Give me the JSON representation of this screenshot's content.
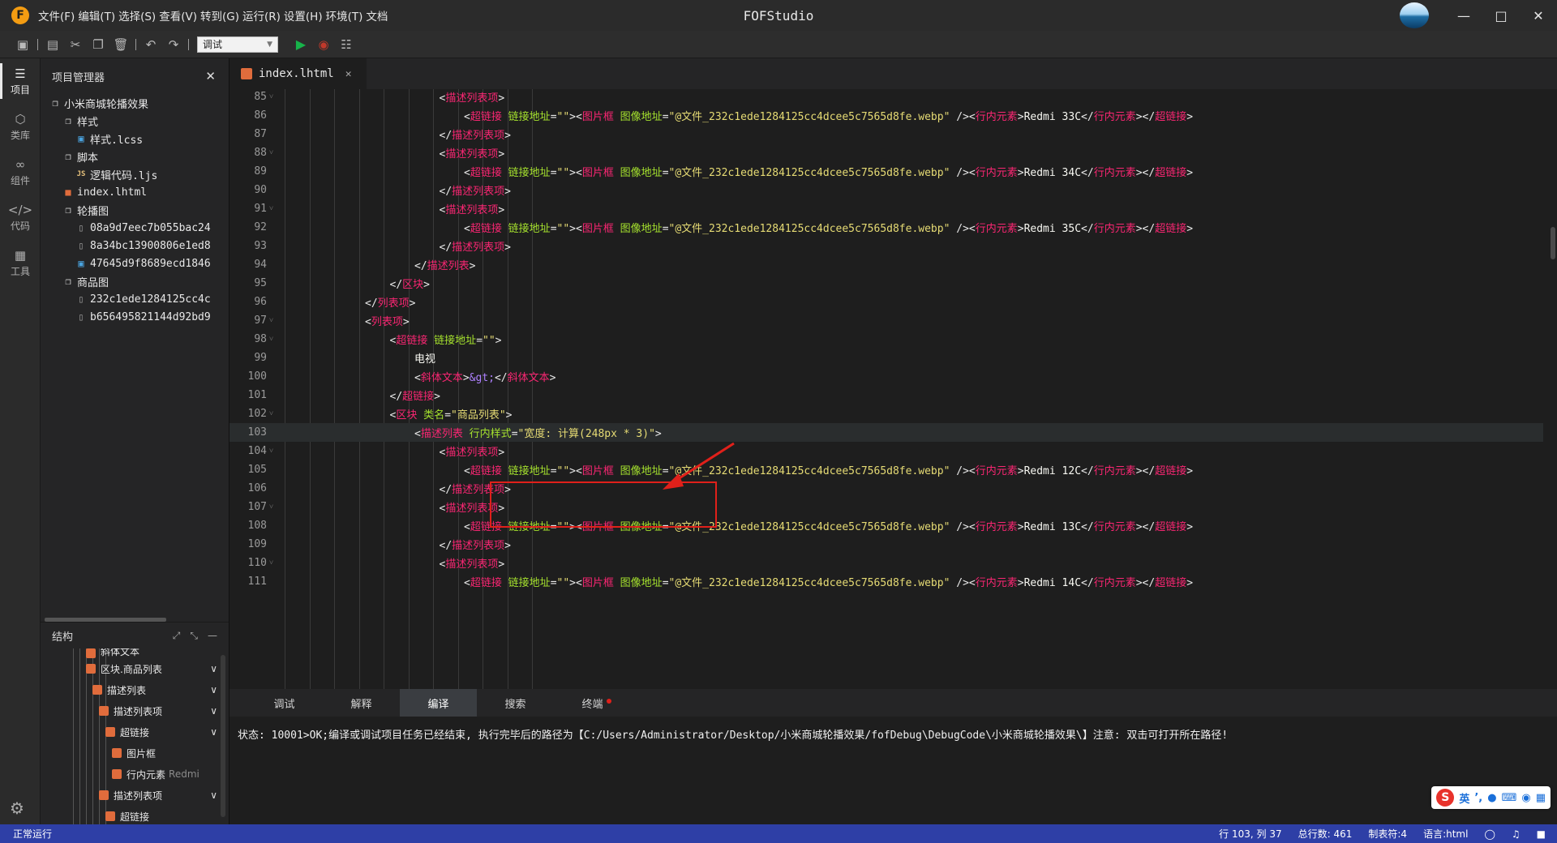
{
  "app": {
    "title": "FOFStudio",
    "logo_letter": "F"
  },
  "menu": [
    "文件(F)",
    "编辑(T)",
    "选择(S)",
    "查看(V)",
    "转到(G)",
    "运行(R)",
    "设置(H)",
    "环境(T)",
    "文档"
  ],
  "toolbar": {
    "run_mode": "调试",
    "icons": [
      "save-icon",
      "save-all-icon",
      "cut-icon",
      "copy-icon",
      "delete-icon",
      "undo-icon",
      "redo-icon",
      "run-icon",
      "stop-icon",
      "search-files-icon"
    ]
  },
  "activity": [
    {
      "label": "项目",
      "icon": "layers-icon"
    },
    {
      "label": "类库",
      "icon": "cube-icon"
    },
    {
      "label": "组件",
      "icon": "link-icon"
    },
    {
      "label": "代码",
      "icon": "code-icon"
    },
    {
      "label": "工具",
      "icon": "tools-icon"
    }
  ],
  "project_panel": {
    "title": "项目管理器",
    "tree": [
      {
        "label": "小米商城轮播效果",
        "type": "folder",
        "depth": 0
      },
      {
        "label": "样式",
        "type": "folder",
        "depth": 1
      },
      {
        "label": "样式.lcss",
        "type": "css",
        "depth": 2
      },
      {
        "label": "脚本",
        "type": "folder",
        "depth": 1
      },
      {
        "label": "逻辑代码.ljs",
        "type": "js",
        "depth": 2
      },
      {
        "label": "index.lhtml",
        "type": "html",
        "depth": 1
      },
      {
        "label": "轮播图",
        "type": "folder",
        "depth": 1
      },
      {
        "label": "08a9d7eec7b055bac24",
        "type": "file",
        "depth": 2
      },
      {
        "label": "8a34bc13900806e1ed8",
        "type": "file",
        "depth": 2
      },
      {
        "label": "47645d9f8689ecd1846",
        "type": "image",
        "depth": 2
      },
      {
        "label": "商品图",
        "type": "folder",
        "depth": 1
      },
      {
        "label": "232c1ede1284125cc4c",
        "type": "file",
        "depth": 2
      },
      {
        "label": "b656495821144d92bd9",
        "type": "file",
        "depth": 2
      }
    ]
  },
  "structure_panel": {
    "title": "结构",
    "nodes": [
      {
        "label": "斜体文本",
        "extra": "",
        "depth": 1,
        "chev": false
      },
      {
        "label": "区块.商品列表",
        "extra": "",
        "depth": 1,
        "chev": true
      },
      {
        "label": "描述列表",
        "extra": "",
        "depth": 2,
        "chev": true
      },
      {
        "label": "描述列表项",
        "extra": "",
        "depth": 3,
        "chev": true
      },
      {
        "label": "超链接",
        "extra": "",
        "depth": 4,
        "chev": true
      },
      {
        "label": "图片框",
        "extra": "",
        "depth": 5,
        "chev": false
      },
      {
        "label": "行内元素",
        "extra": "Redmi",
        "depth": 5,
        "chev": false
      },
      {
        "label": "描述列表项",
        "extra": "",
        "depth": 3,
        "chev": true
      },
      {
        "label": "超链接",
        "extra": "",
        "depth": 4,
        "chev": false
      }
    ]
  },
  "editor": {
    "tab": "index.lhtml",
    "current_line": 103,
    "lines": [
      {
        "n": "85",
        "fold": true,
        "indent": 9,
        "parts": [
          [
            "tg",
            "<"
          ],
          [
            "tn",
            "描述列表项"
          ],
          [
            "tg",
            ">"
          ]
        ]
      },
      {
        "n": "86",
        "fold": false,
        "indent": 10,
        "parts": [
          [
            "tg",
            "<"
          ],
          [
            "tn",
            "超链接"
          ],
          [
            "tx",
            " "
          ],
          [
            "at",
            "链接地址"
          ],
          [
            "tg",
            "="
          ],
          [
            "st",
            "\"\""
          ],
          [
            "tg",
            "><"
          ],
          [
            "tn",
            "图片框"
          ],
          [
            "tx",
            " "
          ],
          [
            "at",
            "图像地址"
          ],
          [
            "tg",
            "="
          ],
          [
            "st",
            "\"@文件_232c1ede1284125cc4dcee5c7565d8fe.webp\""
          ],
          [
            "tx",
            " "
          ],
          [
            "tg",
            "/><"
          ],
          [
            "tn",
            "行内元素"
          ],
          [
            "tg",
            ">"
          ],
          [
            "tx",
            "Redmi 33C"
          ],
          [
            "tg",
            "</"
          ],
          [
            "tn",
            "行内元素"
          ],
          [
            "tg",
            "></"
          ],
          [
            "tn",
            "超链接"
          ],
          [
            "tg",
            ">"
          ]
        ]
      },
      {
        "n": "87",
        "fold": false,
        "indent": 9,
        "parts": [
          [
            "tg",
            "</"
          ],
          [
            "tn",
            "描述列表项"
          ],
          [
            "tg",
            ">"
          ]
        ]
      },
      {
        "n": "88",
        "fold": true,
        "indent": 9,
        "parts": [
          [
            "tg",
            "<"
          ],
          [
            "tn",
            "描述列表项"
          ],
          [
            "tg",
            ">"
          ]
        ]
      },
      {
        "n": "89",
        "fold": false,
        "indent": 10,
        "parts": [
          [
            "tg",
            "<"
          ],
          [
            "tn",
            "超链接"
          ],
          [
            "tx",
            " "
          ],
          [
            "at",
            "链接地址"
          ],
          [
            "tg",
            "="
          ],
          [
            "st",
            "\"\""
          ],
          [
            "tg",
            "><"
          ],
          [
            "tn",
            "图片框"
          ],
          [
            "tx",
            " "
          ],
          [
            "at",
            "图像地址"
          ],
          [
            "tg",
            "="
          ],
          [
            "st",
            "\"@文件_232c1ede1284125cc4dcee5c7565d8fe.webp\""
          ],
          [
            "tx",
            " "
          ],
          [
            "tg",
            "/><"
          ],
          [
            "tn",
            "行内元素"
          ],
          [
            "tg",
            ">"
          ],
          [
            "tx",
            "Redmi 34C"
          ],
          [
            "tg",
            "</"
          ],
          [
            "tn",
            "行内元素"
          ],
          [
            "tg",
            "></"
          ],
          [
            "tn",
            "超链接"
          ],
          [
            "tg",
            ">"
          ]
        ]
      },
      {
        "n": "90",
        "fold": false,
        "indent": 9,
        "parts": [
          [
            "tg",
            "</"
          ],
          [
            "tn",
            "描述列表项"
          ],
          [
            "tg",
            ">"
          ]
        ]
      },
      {
        "n": "91",
        "fold": true,
        "indent": 9,
        "parts": [
          [
            "tg",
            "<"
          ],
          [
            "tn",
            "描述列表项"
          ],
          [
            "tg",
            ">"
          ]
        ]
      },
      {
        "n": "92",
        "fold": false,
        "indent": 10,
        "parts": [
          [
            "tg",
            "<"
          ],
          [
            "tn",
            "超链接"
          ],
          [
            "tx",
            " "
          ],
          [
            "at",
            "链接地址"
          ],
          [
            "tg",
            "="
          ],
          [
            "st",
            "\"\""
          ],
          [
            "tg",
            "><"
          ],
          [
            "tn",
            "图片框"
          ],
          [
            "tx",
            " "
          ],
          [
            "at",
            "图像地址"
          ],
          [
            "tg",
            "="
          ],
          [
            "st",
            "\"@文件_232c1ede1284125cc4dcee5c7565d8fe.webp\""
          ],
          [
            "tx",
            " "
          ],
          [
            "tg",
            "/><"
          ],
          [
            "tn",
            "行内元素"
          ],
          [
            "tg",
            ">"
          ],
          [
            "tx",
            "Redmi 35C"
          ],
          [
            "tg",
            "</"
          ],
          [
            "tn",
            "行内元素"
          ],
          [
            "tg",
            "></"
          ],
          [
            "tn",
            "超链接"
          ],
          [
            "tg",
            ">"
          ]
        ]
      },
      {
        "n": "93",
        "fold": false,
        "indent": 9,
        "parts": [
          [
            "tg",
            "</"
          ],
          [
            "tn",
            "描述列表项"
          ],
          [
            "tg",
            ">"
          ]
        ]
      },
      {
        "n": "94",
        "fold": false,
        "indent": 8,
        "parts": [
          [
            "tg",
            "</"
          ],
          [
            "tn",
            "描述列表"
          ],
          [
            "tg",
            ">"
          ]
        ]
      },
      {
        "n": "95",
        "fold": false,
        "indent": 7,
        "parts": [
          [
            "tg",
            "</"
          ],
          [
            "tn",
            "区块"
          ],
          [
            "tg",
            ">"
          ]
        ]
      },
      {
        "n": "96",
        "fold": false,
        "indent": 6,
        "parts": [
          [
            "tg",
            "</"
          ],
          [
            "tn",
            "列表项"
          ],
          [
            "tg",
            ">"
          ]
        ]
      },
      {
        "n": "97",
        "fold": true,
        "indent": 6,
        "parts": [
          [
            "tg",
            "<"
          ],
          [
            "tn",
            "列表项"
          ],
          [
            "tg",
            ">"
          ]
        ]
      },
      {
        "n": "98",
        "fold": true,
        "indent": 7,
        "parts": [
          [
            "tg",
            "<"
          ],
          [
            "tn",
            "超链接"
          ],
          [
            "tx",
            " "
          ],
          [
            "at",
            "链接地址"
          ],
          [
            "tg",
            "="
          ],
          [
            "st",
            "\"\""
          ],
          [
            "tg",
            ">"
          ]
        ]
      },
      {
        "n": "99",
        "fold": false,
        "indent": 8,
        "parts": [
          [
            "tx",
            "电视"
          ]
        ]
      },
      {
        "n": "100",
        "fold": false,
        "indent": 8,
        "parts": [
          [
            "tg",
            "<"
          ],
          [
            "tn",
            "斜体文本"
          ],
          [
            "tg",
            ">"
          ],
          [
            "en",
            "&gt;"
          ],
          [
            "tg",
            "</"
          ],
          [
            "tn",
            "斜体文本"
          ],
          [
            "tg",
            ">"
          ]
        ]
      },
      {
        "n": "101",
        "fold": false,
        "indent": 7,
        "parts": [
          [
            "tg",
            "</"
          ],
          [
            "tn",
            "超链接"
          ],
          [
            "tg",
            ">"
          ]
        ]
      },
      {
        "n": "102",
        "fold": true,
        "indent": 7,
        "parts": [
          [
            "tg",
            "<"
          ],
          [
            "tn",
            "区块"
          ],
          [
            "tx",
            " "
          ],
          [
            "at",
            "类名"
          ],
          [
            "tg",
            "="
          ],
          [
            "st",
            "\"商品列表\""
          ],
          [
            "tg",
            ">"
          ]
        ]
      },
      {
        "n": "103",
        "fold": false,
        "indent": 8,
        "parts": [
          [
            "tg",
            "<"
          ],
          [
            "tn",
            "描述列表"
          ],
          [
            "tx",
            " "
          ],
          [
            "at",
            "行内样式"
          ],
          [
            "tg",
            "="
          ],
          [
            "st",
            "\"宽度: 计算(248px * 3)\""
          ],
          [
            "tg",
            ">"
          ]
        ]
      },
      {
        "n": "104",
        "fold": true,
        "indent": 9,
        "parts": [
          [
            "tg",
            "<"
          ],
          [
            "tn",
            "描述列表项"
          ],
          [
            "tg",
            ">"
          ]
        ]
      },
      {
        "n": "105",
        "fold": false,
        "indent": 10,
        "parts": [
          [
            "tg",
            "<"
          ],
          [
            "tn",
            "超链接"
          ],
          [
            "tx",
            " "
          ],
          [
            "at",
            "链接地址"
          ],
          [
            "tg",
            "="
          ],
          [
            "st",
            "\"\""
          ],
          [
            "tg",
            "><"
          ],
          [
            "tn",
            "图片框"
          ],
          [
            "tx",
            " "
          ],
          [
            "at",
            "图像地址"
          ],
          [
            "tg",
            "="
          ],
          [
            "st",
            "\"@文件_232c1ede1284125cc4dcee5c7565d8fe.webp\""
          ],
          [
            "tx",
            " "
          ],
          [
            "tg",
            "/><"
          ],
          [
            "tn",
            "行内元素"
          ],
          [
            "tg",
            ">"
          ],
          [
            "tx",
            "Redmi 12C"
          ],
          [
            "tg",
            "</"
          ],
          [
            "tn",
            "行内元素"
          ],
          [
            "tg",
            "></"
          ],
          [
            "tn",
            "超链接"
          ],
          [
            "tg",
            ">"
          ]
        ]
      },
      {
        "n": "106",
        "fold": false,
        "indent": 9,
        "parts": [
          [
            "tg",
            "</"
          ],
          [
            "tn",
            "描述列表项"
          ],
          [
            "tg",
            ">"
          ]
        ]
      },
      {
        "n": "107",
        "fold": true,
        "indent": 9,
        "parts": [
          [
            "tg",
            "<"
          ],
          [
            "tn",
            "描述列表项"
          ],
          [
            "tg",
            ">"
          ]
        ]
      },
      {
        "n": "108",
        "fold": false,
        "indent": 10,
        "parts": [
          [
            "tg",
            "<"
          ],
          [
            "tn",
            "超链接"
          ],
          [
            "tx",
            " "
          ],
          [
            "at",
            "链接地址"
          ],
          [
            "tg",
            "="
          ],
          [
            "st",
            "\"\""
          ],
          [
            "tg",
            "><"
          ],
          [
            "tn",
            "图片框"
          ],
          [
            "tx",
            " "
          ],
          [
            "at",
            "图像地址"
          ],
          [
            "tg",
            "="
          ],
          [
            "st",
            "\"@文件_232c1ede1284125cc4dcee5c7565d8fe.webp\""
          ],
          [
            "tx",
            " "
          ],
          [
            "tg",
            "/><"
          ],
          [
            "tn",
            "行内元素"
          ],
          [
            "tg",
            ">"
          ],
          [
            "tx",
            "Redmi 13C"
          ],
          [
            "tg",
            "</"
          ],
          [
            "tn",
            "行内元素"
          ],
          [
            "tg",
            "></"
          ],
          [
            "tn",
            "超链接"
          ],
          [
            "tg",
            ">"
          ]
        ]
      },
      {
        "n": "109",
        "fold": false,
        "indent": 9,
        "parts": [
          [
            "tg",
            "</"
          ],
          [
            "tn",
            "描述列表项"
          ],
          [
            "tg",
            ">"
          ]
        ]
      },
      {
        "n": "110",
        "fold": true,
        "indent": 9,
        "parts": [
          [
            "tg",
            "<"
          ],
          [
            "tn",
            "描述列表项"
          ],
          [
            "tg",
            ">"
          ]
        ]
      },
      {
        "n": "111",
        "fold": false,
        "indent": 10,
        "parts": [
          [
            "tg",
            "<"
          ],
          [
            "tn",
            "超链接"
          ],
          [
            "tx",
            " "
          ],
          [
            "at",
            "链接地址"
          ],
          [
            "tg",
            "="
          ],
          [
            "st",
            "\"\""
          ],
          [
            "tg",
            "><"
          ],
          [
            "tn",
            "图片框"
          ],
          [
            "tx",
            " "
          ],
          [
            "at",
            "图像地址"
          ],
          [
            "tg",
            "="
          ],
          [
            "st",
            "\"@文件_232c1ede1284125cc4dcee5c7565d8fe.webp\""
          ],
          [
            "tx",
            " "
          ],
          [
            "tg",
            "/><"
          ],
          [
            "tn",
            "行内元素"
          ],
          [
            "tg",
            ">"
          ],
          [
            "tx",
            "Redmi 14C"
          ],
          [
            "tg",
            "</"
          ],
          [
            "tn",
            "行内元素"
          ],
          [
            "tg",
            "></"
          ],
          [
            "tn",
            "超链接"
          ],
          [
            "tg",
            ">"
          ]
        ]
      }
    ]
  },
  "bottom_panel": {
    "tabs": [
      "调试",
      "解释",
      "编译",
      "搜索",
      "终端"
    ],
    "active_tab": "编译",
    "output": "状态: 10001>OK;编译或调试项目任务已经结束, 执行完毕后的路径为【C:/Users/Administrator/Desktop/小米商城轮播效果/fofDebug\\DebugCode\\小米商城轮播效果\\】注意: 双击可打开所在路径!"
  },
  "ime": {
    "logo": "S",
    "lang": "英"
  },
  "status": {
    "left": "正常运行",
    "position": "行 103, 列 37",
    "total_lines": "总行数: 461",
    "tab_size": "制表符:4",
    "language": "语言:html"
  },
  "colors": {
    "accent": "#2e3fa6",
    "highlight_box": "#e0201a"
  }
}
